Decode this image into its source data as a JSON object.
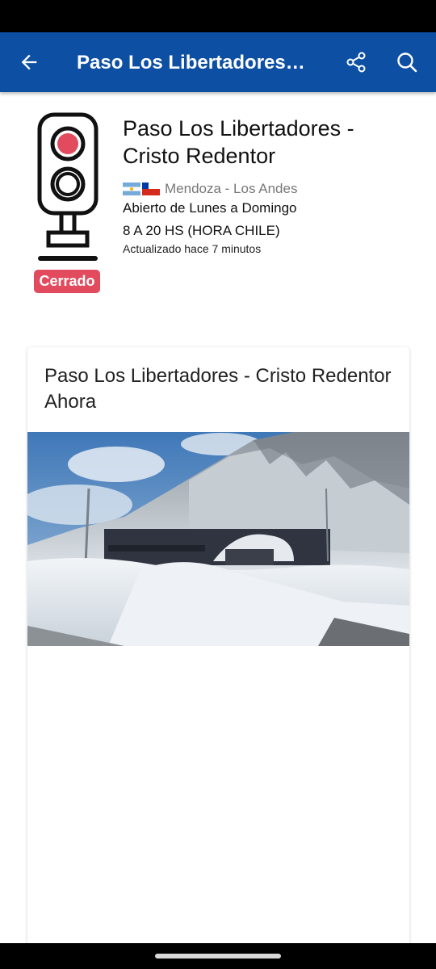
{
  "app_bar": {
    "title": "Paso Los Libertadores - Cristo Redentor",
    "back_icon": "arrow-back-icon",
    "share_icon": "share-icon",
    "search_icon": "search-icon",
    "color": "#0d4fa3"
  },
  "pass": {
    "title": "Paso Los Libertadores - Cristo Redentor",
    "status": "Cerrado",
    "status_color": "#e24a5e",
    "flags": [
      "argentina-flag",
      "chile-flag"
    ],
    "route": "Mendoza - Los Andes",
    "schedule_days": "Abierto de Lunes a Domingo",
    "schedule_hours": "8 A 20 HS (HORA CHILE)",
    "updated": "Actualizado hace 7 minutos"
  },
  "card": {
    "title": "Paso Los Libertadores - Cristo Redentor Ahora"
  }
}
